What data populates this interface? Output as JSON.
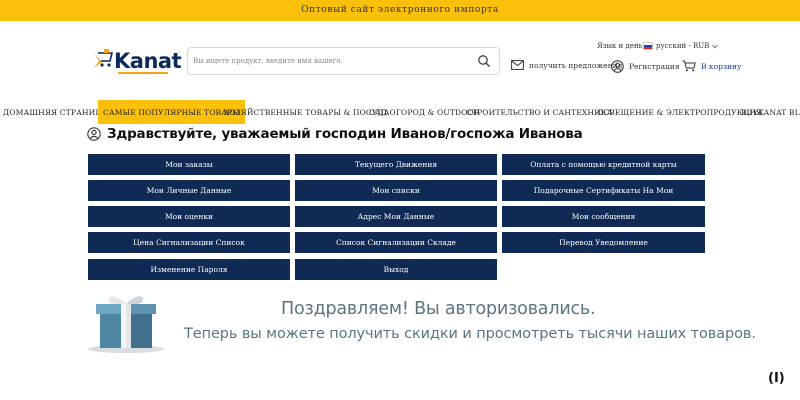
{
  "topbar": {
    "text": "Оптовый сайт электронного импорта"
  },
  "logo": {
    "text": "Kanat"
  },
  "search": {
    "placeholder": "Вы ищете продукт, введите имя вашего."
  },
  "header": {
    "lang_label": "Язык и деньги:",
    "lang_value": "русский - RUB",
    "offers_label": "получить предложения",
    "register_label": "Регистрация",
    "cart_label": "В корзину"
  },
  "nav": {
    "items": [
      {
        "label": "ДОМАШНЯЯ СТРАНИЦА"
      },
      {
        "label": "САМЫЕ ПОПУЛЯРНЫЕ ТОВАРЫ"
      },
      {
        "label": "ХОЗЯЙСТВЕННЫЕ ТОВАРЫ & ПОСУДА"
      },
      {
        "label": "САД ОГОРОД & OUTDOOR"
      },
      {
        "label": "СТРОИТЕЛЬСТВО И САНТЕХНИКА"
      },
      {
        "label": "ОСВЕЩЕНИЕ & ЭЛЕКТРОПРОДУКЦИЯ"
      },
      {
        "label": "BUYKANAT BLOG"
      }
    ]
  },
  "greeting": {
    "text": "Здравствуйте, уважаемый господин Иванов/госпожа  Иванова"
  },
  "account_buttons": [
    {
      "label": "Мои заказы"
    },
    {
      "label": "Текущего Движения"
    },
    {
      "label": "Оплата с помощью кредитной карты"
    },
    {
      "label": "Мои Личные Данные"
    },
    {
      "label": "Мои списки"
    },
    {
      "label": "Подарочные Сертификаты На Мои"
    },
    {
      "label": "Мои оценки"
    },
    {
      "label": "Адрес Мои Данные"
    },
    {
      "label": "Мои сообщения"
    },
    {
      "label": "Цена Сигнализации Список"
    },
    {
      "label": "Список Сигнализации Складе"
    },
    {
      "label": "Перевод Уведомление"
    },
    {
      "label": "Изменение Пароля"
    },
    {
      "label": "Выход"
    }
  ],
  "promo": {
    "line1": "Поздравляем! Вы авторизовались.",
    "line2": "Теперь вы можете получить скидки и просмотреть тысячи наших товаров."
  },
  "corner_label": "(I)",
  "colors": {
    "accent": "#fbc10a",
    "button": "#0f2b55",
    "promo_text": "#5a7482"
  }
}
